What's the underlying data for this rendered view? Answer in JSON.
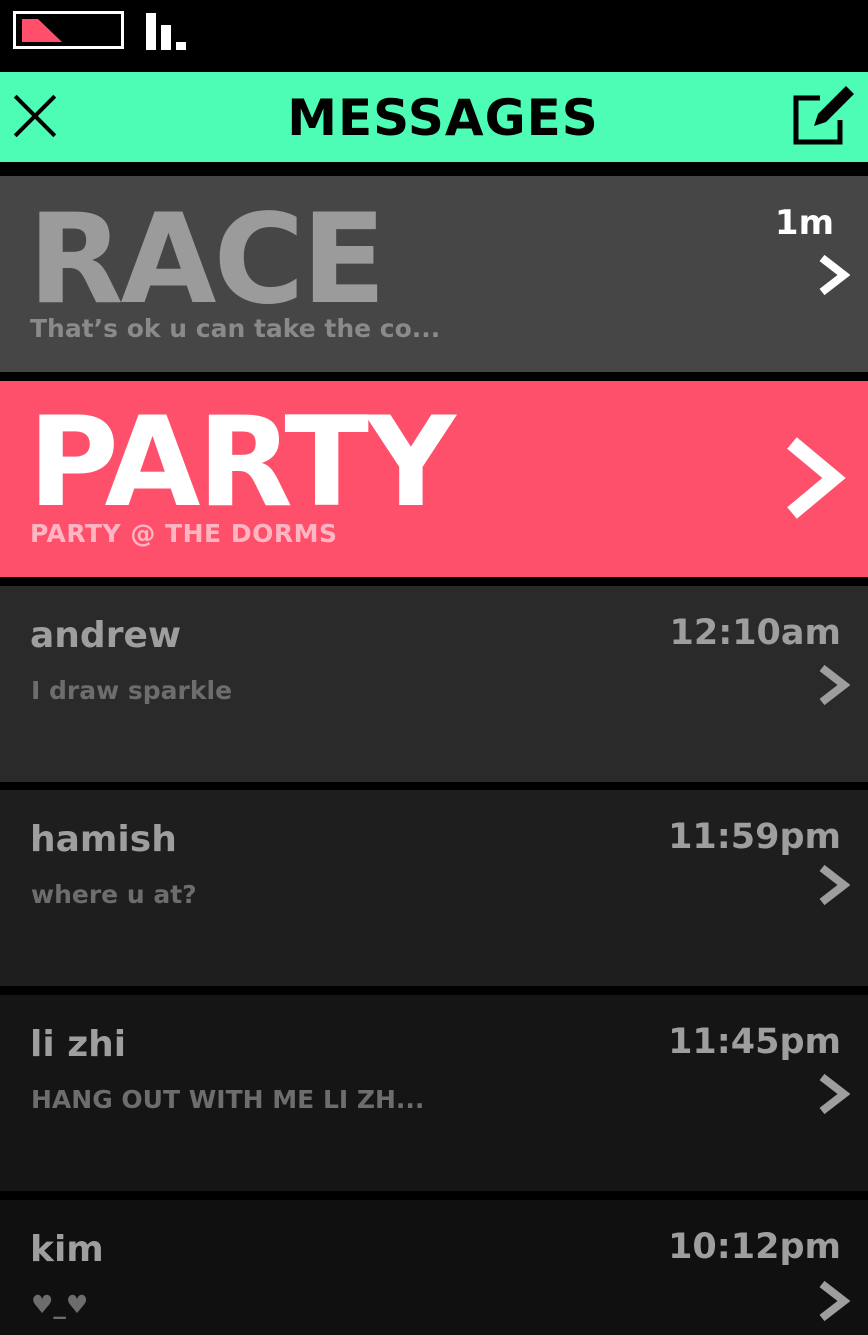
{
  "status_bar": {
    "battery_level": 0.4,
    "signal_bars": 3,
    "accent_color": "#ff4f6b"
  },
  "header": {
    "title": "MESSAGES",
    "close_icon": "close-icon",
    "compose_icon": "compose-icon",
    "background": "#4dfdb5"
  },
  "groups": [
    {
      "name": "RACE",
      "preview": "That’s ok u can take the co...",
      "time": "1m",
      "background": "#464646"
    },
    {
      "name": "PARTY",
      "preview": "PARTY @ THE DORMS",
      "time": "",
      "background": "#fe506b"
    }
  ],
  "messages": [
    {
      "name": "andrew",
      "snippet": "I draw sparkle",
      "time": "12:10am"
    },
    {
      "name": "hamish",
      "snippet": "where u at?",
      "time": "11:59pm"
    },
    {
      "name": "li zhi",
      "snippet": "HANG OUT WITH ME LI ZH...",
      "time": "11:45pm"
    },
    {
      "name": "kim",
      "snippet": "♥_♥",
      "time": "10:12pm"
    }
  ]
}
